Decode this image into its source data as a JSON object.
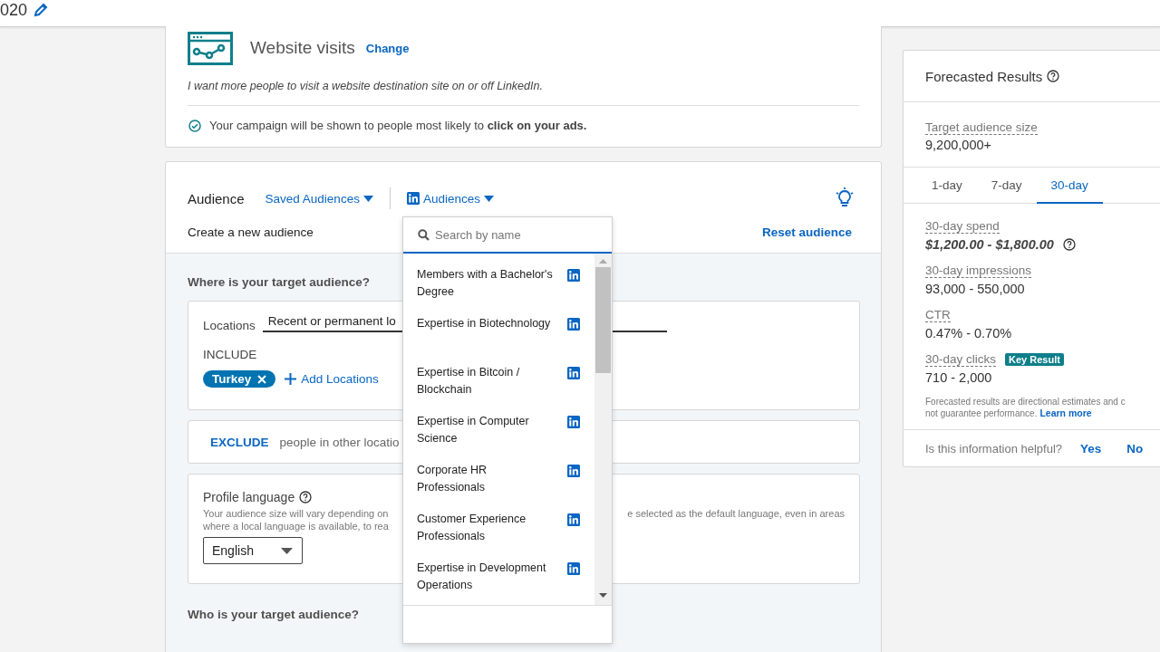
{
  "header": {
    "title_fragment": "020"
  },
  "objective": {
    "title": "Website visits",
    "change_link": "Change",
    "description": "I want more people to visit a website destination site on or off LinkedIn.",
    "note": "Your campaign will be shown to people most likely to **click on your ads.**"
  },
  "audience": {
    "title": "Audience",
    "saved_audiences": "Saved Audiences",
    "audiences_menu": "Audiences",
    "create_label": "Create a new audience",
    "reset_link": "Reset audience",
    "dropdown": {
      "placeholder": "Search by name",
      "items": [
        {
          "name": "Members with a Bachelor's Degree"
        },
        {
          "name": "Expertise in Biotechnology"
        },
        {
          "name": "Expertise in Bitcoin / Blockchain"
        },
        {
          "name": "Expertise in Computer Science"
        },
        {
          "name": "Corporate HR Professionals"
        },
        {
          "name": "Customer Experience Professionals"
        },
        {
          "name": "Expertise in Development Operations"
        }
      ]
    },
    "where_heading": "Where is your target audience?",
    "locations": {
      "label": "Locations",
      "mode": "Recent or permanent lo",
      "include_label": "INCLUDE",
      "chips": [
        "Turkey"
      ],
      "add_link": "Add Locations"
    },
    "exclude": {
      "label": "EXCLUDE",
      "text": "people in other locatio"
    },
    "profile_language": {
      "title": "Profile language",
      "description_left": "Your audience size will vary depending on",
      "description_right": "e selected as the default language, even in areas",
      "description_line2": "where a local language is available, to rea",
      "value": "English"
    },
    "who_heading": "Who is your target audience?"
  },
  "forecast": {
    "title": "Forecasted Results",
    "audience_size_label": "Target audience size",
    "audience_size": "9,200,000+",
    "tabs": [
      {
        "label": "1-day",
        "selected": false
      },
      {
        "label": "7-day",
        "selected": false
      },
      {
        "label": "30-day",
        "selected": true
      }
    ],
    "metrics": [
      {
        "kind": "spend",
        "label": "30-day spend",
        "value": "$1,200.00 - $1,800.00"
      },
      {
        "kind": "count",
        "label": "30-day impressions",
        "value": "93,000 - 550,000"
      },
      {
        "kind": "count",
        "label": "CTR",
        "value": "0.47% - 0.70%"
      },
      {
        "kind": "count",
        "label": "30-day clicks",
        "value": "710 - 2,000",
        "badge": "Key Result"
      }
    ],
    "disclaimer_line1": "Forecasted results are directional estimates and c",
    "disclaimer_line2": "not guarantee performance.",
    "learn_more": "Learn more",
    "helpful_question": "Is this information helpful?",
    "yes": "Yes",
    "no": "No"
  }
}
